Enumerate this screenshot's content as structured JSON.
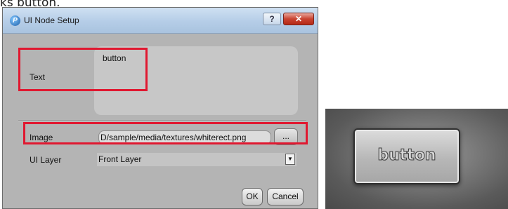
{
  "caption": "ks button.",
  "dialog": {
    "title": "UI Node Setup",
    "help_label": "?",
    "close_label": "✕",
    "text_label": "Text",
    "text_value": "button",
    "image_label": "Image",
    "image_path": "D/sample/media/textures/whiterect.png",
    "browse_label": "...",
    "layer_label": "UI Layer",
    "layer_value": "Front Layer",
    "ok_label": "OK",
    "cancel_label": "Cancel"
  },
  "preview": {
    "button_text": "button"
  },
  "colors": {
    "highlight": "#e01830",
    "dialog_bg": "#b4b4b4"
  },
  "icons": {
    "app": "app-logo-icon",
    "dropdown": "chevron-down-icon"
  }
}
